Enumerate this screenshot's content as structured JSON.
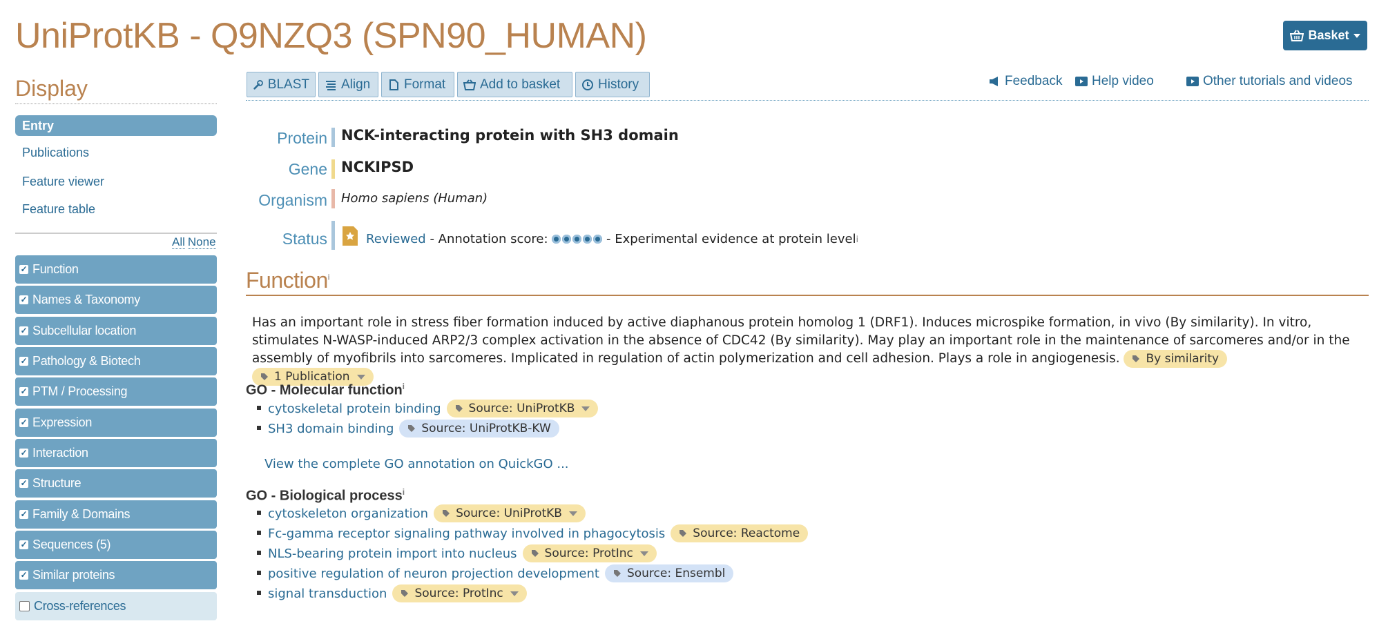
{
  "header": {
    "title": "UniProtKB - Q9NZQ3 (SPN90_HUMAN)",
    "basket_label": "Basket"
  },
  "sidebar": {
    "heading": "Display",
    "views": [
      "Entry",
      "Publications",
      "Feature viewer",
      "Feature table"
    ],
    "all_label": "All",
    "none_label": "None",
    "sections": [
      {
        "label": "Function",
        "checked": true
      },
      {
        "label": "Names & Taxonomy",
        "checked": true
      },
      {
        "label": "Subcellular location",
        "checked": true
      },
      {
        "label": "Pathology & Biotech",
        "checked": true
      },
      {
        "label": "PTM / Processing",
        "checked": true
      },
      {
        "label": "Expression",
        "checked": true
      },
      {
        "label": "Interaction",
        "checked": true
      },
      {
        "label": "Structure",
        "checked": true
      },
      {
        "label": "Family & Domains",
        "checked": true
      },
      {
        "label": "Sequences (5)",
        "checked": true
      },
      {
        "label": "Similar proteins",
        "checked": true
      },
      {
        "label": "Cross-references",
        "checked": false
      }
    ]
  },
  "toolbar": {
    "blast": "BLAST",
    "align": "Align",
    "format": "Format",
    "add_to_basket": "Add to basket",
    "history": "History"
  },
  "help_links": {
    "feedback": "Feedback",
    "help_video": "Help video",
    "tutorials": "Other tutorials and videos"
  },
  "summary": {
    "protein_label": "Protein",
    "protein_value": "NCK-interacting protein with SH3 domain",
    "gene_label": "Gene",
    "gene_value": "NCKIPSD",
    "organism_label": "Organism",
    "organism_value": "Homo sapiens (Human)",
    "status_label": "Status",
    "status_reviewed": "Reviewed",
    "annotation_score_label": " - Annotation score: ",
    "annotation_score": 5,
    "evidence_text": " - Experimental evidence at protein level",
    "info_marker": "i"
  },
  "function": {
    "heading": "Function",
    "text": "Has an important role in stress fiber formation induced by active diaphanous protein homolog 1 (DRF1). Induces microspike formation, in vivo (By similarity). In vitro, stimulates N-WASP-induced ARP2/3 complex activation in the absence of CDC42 (By similarity). May play an important role in the maintenance of sarcomeres and/or in the assembly of myofibrils into sarcomeres. Implicated in regulation of actin polymerization and cell adhesion. Plays a role in angiogenesis.",
    "tag1": "By similarity",
    "tag2": "1 Publication"
  },
  "go_molecular": {
    "heading": "GO - Molecular function",
    "items": [
      {
        "term": "cytoskeletal protein binding",
        "source": "Source: UniProtKB"
      },
      {
        "term": "SH3 domain binding",
        "source": "Source: UniProtKB-KW"
      }
    ],
    "quickgo": "View the complete GO annotation on QuickGO ..."
  },
  "go_biological": {
    "heading": "GO - Biological process",
    "items": [
      {
        "term": "cytoskeleton organization",
        "source": "Source: UniProtKB"
      },
      {
        "term": "Fc-gamma receptor signaling pathway involved in phagocytosis",
        "source": "Source: Reactome"
      },
      {
        "term": "NLS-bearing protein import into nucleus",
        "source": "Source: ProtInc"
      },
      {
        "term": "positive regulation of neuron projection development",
        "source": "Source: Ensembl"
      },
      {
        "term": "signal transduction",
        "source": "Source: ProtInc"
      }
    ]
  },
  "colors": {
    "brand_brown": "#b9824f",
    "link_blue": "#2a6b94",
    "nav_blue": "#6fa3c2",
    "tag_yellow": "#f7e4a8",
    "tag_blue": "#d3e2f6"
  }
}
